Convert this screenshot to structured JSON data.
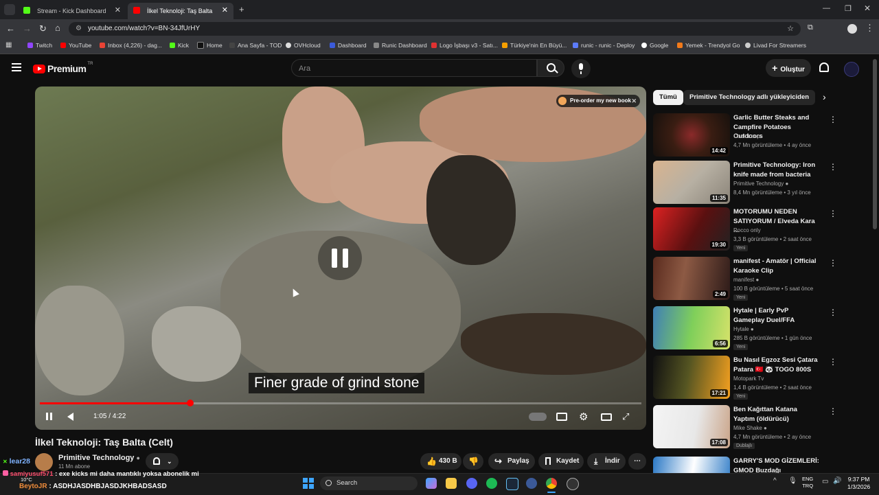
{
  "browser": {
    "tabs": [
      {
        "label": "Stream - Kick Dashboard",
        "color": "#53fc18"
      },
      {
        "label": "İlkel Teknoloji: Taş Balta (Celt)",
        "color": "#ff0000"
      }
    ],
    "url": "youtube.com/watch?v=BN-34JfUrHY",
    "bookmarks": [
      "Twitch",
      "YouTube",
      "Inbox (4,226) - dag...",
      "Kick",
      "Home",
      "Ana Sayfa - TOD",
      "OVHcloud",
      "Dashboard",
      "Runic Dashboard",
      "Logo İşbaşı v3 - Satı...",
      "Türkiye'nin En Büyü...",
      "runic - runic - Deploy",
      "Google",
      "Yemek - Trendyol Go",
      "Livad For Streamers"
    ]
  },
  "youtube": {
    "logo_text": "Premium",
    "logo_sup": "TR",
    "search_placeholder": "Ara",
    "create_label": "Oluştur"
  },
  "video": {
    "subtitle": "Finer grade of grind stone",
    "time": "1:05 / 4:22",
    "progress": 0.25,
    "preorder": "Pre-order my new book",
    "title": "İlkel Teknoloji: Taş Balta (Celt)",
    "channel": "Primitive Technology",
    "subscribers": "11 Mn abone",
    "likes": "430 B",
    "share": "Paylaş",
    "save": "Kaydet",
    "download": "İndir"
  },
  "sidebar": {
    "chips": [
      "Tümü",
      "Primitive Technology adlı yükleyiciden"
    ],
    "recs": [
      {
        "title": "Garlic Butter Steaks and Campfire Potatoes Outdoors",
        "channel": "Cook Loop",
        "meta": "4,7 Mn görüntüleme • 4 ay önce",
        "duration": "14:42",
        "new": ""
      },
      {
        "title": "Primitive Technology: Iron knife made from bacteria",
        "channel": "Primitive Technology",
        "meta": "8,4 Mn görüntüleme • 3 yıl önce",
        "duration": "11:35",
        "new": ""
      },
      {
        "title": "MOTORUMU NEDEN SATIYORUM / Elveda Kara ...",
        "channel": "Rocco only",
        "meta": "3,3 B görüntüleme • 2 saat önce",
        "duration": "19:30",
        "new": "Yeni"
      },
      {
        "title": "manifest - Amatör | Official Karaoke Clip",
        "channel": "manifest",
        "meta": "100 B görüntüleme • 5 saat önce",
        "duration": "2:49",
        "new": "Yeni"
      },
      {
        "title": "Hytale | Early PvP Gameplay Duel/FFA",
        "channel": "Hytale",
        "meta": "285 B görüntüleme • 1 gün önce",
        "duration": "6:56",
        "new": "Yeni"
      },
      {
        "title": "Bu Nasıl Egzoz Sesi Çatara Patara 🇹🇷 🐼 TOGO 800S",
        "channel": "Motopark Tv",
        "meta": "1,4 B görüntüleme • 2 saat önce",
        "duration": "17:21",
        "new": "Yeni"
      },
      {
        "title": "Ben Kağıttan Katana Yaptım (öldürücü)",
        "channel": "Mike Shake",
        "meta": "4,7 Mn görüntüleme • 2 ay önce",
        "duration": "17:08",
        "new": "Dublajlı"
      },
      {
        "title": "GARRY'S MOD GİZEMLERİ: GMOD Buzdağı",
        "channel": "",
        "meta": "",
        "duration": "",
        "new": ""
      }
    ]
  },
  "overlay": {
    "chat": [
      {
        "user": "lear28",
        "text": ""
      },
      {
        "user": "samiyusuf571",
        "text": "exe kicks mi daha mantıklı yoksa abonelik mi"
      },
      {
        "user": "BeytoJR",
        "text": "ASDHJASDHBJASDJKHBADSASD"
      }
    ]
  },
  "taskbar": {
    "search": "Search",
    "weather": "10°C",
    "lang1": "ENG",
    "lang2": "TRQ",
    "time": "9:37 PM",
    "date": "1/3/2026"
  }
}
